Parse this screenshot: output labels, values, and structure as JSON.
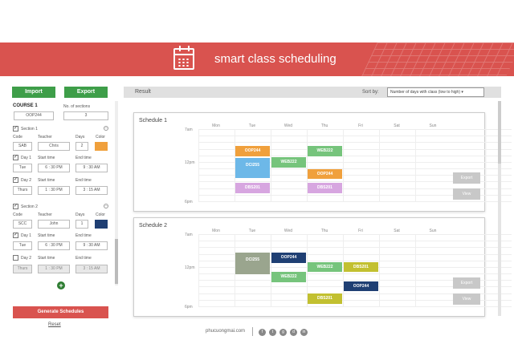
{
  "header": {
    "title": "smart class scheduling",
    "icon": "calendar-icon",
    "color": "#d9534f"
  },
  "toolbar": {
    "import_label": "Import",
    "export_label": "Export"
  },
  "course": {
    "label": "COURSE 1",
    "code": "OOP244",
    "sections_label": "No. of sections",
    "sections_value": "3"
  },
  "fields": {
    "code": "Code",
    "teacher": "Teacher",
    "days": "Days",
    "color": "Color",
    "start": "Start time",
    "end": "End time"
  },
  "sections": [
    {
      "label": "Section 1",
      "code": "SAB",
      "teacher": "Chris",
      "days": "2",
      "color": "#f0a03c",
      "days_list": [
        {
          "label": "Day 1",
          "day": "Tue",
          "start": "6 : 30 PM",
          "end": "9 : 30 AM",
          "checked": true
        },
        {
          "label": "Day 2",
          "day": "Thurs",
          "start": "1 : 30 PM",
          "end": "3 : 15 AM",
          "checked": true
        }
      ]
    },
    {
      "label": "Section 2",
      "code": "SCC",
      "teacher": "John",
      "days": "1",
      "color": "#1f3f73",
      "days_list": [
        {
          "label": "Day 1",
          "day": "Tue",
          "start": "6 : 30 PM",
          "end": "9 : 30 AM",
          "checked": true
        },
        {
          "label": "Day 2",
          "day": "Thurs",
          "start": "1 : 30 PM",
          "end": "3 : 15 AM",
          "checked": false
        }
      ]
    }
  ],
  "actions": {
    "generate": "Generate Schedules",
    "reset": "Reset"
  },
  "result": {
    "title": "Result",
    "sort_label": "Sort by:",
    "sort_value": "Number of days with class (low to high)"
  },
  "days": [
    "Mon",
    "Tue",
    "Wed",
    "Thu",
    "Fri",
    "Sat",
    "Sun"
  ],
  "time_labels": [
    "7am",
    "12pm",
    "6pm"
  ],
  "panel_buttons": {
    "export": "Export",
    "view": "View"
  },
  "schedules": [
    {
      "title": "Schedule 1",
      "blocks": [
        {
          "name": "OOP244",
          "day": 1,
          "start": 9.6,
          "end": 11.1,
          "color": "#f0a03c"
        },
        {
          "name": "DCI255",
          "day": 1,
          "start": 11.4,
          "end": 14.4,
          "color": "#6db8e8"
        },
        {
          "name": "DBS201",
          "day": 1,
          "start": 15.2,
          "end": 16.8,
          "color": "#d7a6e0"
        },
        {
          "name": "WEB222",
          "day": 2,
          "start": 11.3,
          "end": 12.9,
          "color": "#76c47c"
        },
        {
          "name": "WEB222",
          "day": 3,
          "start": 9.6,
          "end": 11.1,
          "color": "#76c47c"
        },
        {
          "name": "OOP244",
          "day": 3,
          "start": 13.1,
          "end": 14.6,
          "color": "#f0a03c"
        },
        {
          "name": "DBS201",
          "day": 3,
          "start": 15.2,
          "end": 16.8,
          "color": "#d7a6e0"
        }
      ]
    },
    {
      "title": "Schedule 2",
      "blocks": [
        {
          "name": "DCI255",
          "day": 1,
          "start": 9.8,
          "end": 13.1,
          "color": "#9aa58e"
        },
        {
          "name": "OOP244",
          "day": 2,
          "start": 9.8,
          "end": 11.4,
          "color": "#1f3f73"
        },
        {
          "name": "WEB222",
          "day": 2,
          "start": 12.8,
          "end": 14.3,
          "color": "#76c47c"
        },
        {
          "name": "WEB222",
          "day": 3,
          "start": 11.3,
          "end": 12.8,
          "color": "#76c47c"
        },
        {
          "name": "DBS201",
          "day": 3,
          "start": 16.0,
          "end": 17.6,
          "color": "#c2c030"
        },
        {
          "name": "DBS201",
          "day": 4,
          "start": 11.3,
          "end": 12.8,
          "color": "#c2c030"
        },
        {
          "name": "OOP244",
          "day": 4,
          "start": 14.2,
          "end": 15.7,
          "color": "#1f3f73"
        }
      ]
    }
  ],
  "footer": {
    "site": "phucuongmai.com",
    "social": [
      "facebook-icon",
      "twitter-icon",
      "github-icon",
      "dribbble-icon",
      "linkedin-icon"
    ],
    "social_glyphs": [
      "f",
      "t",
      "g",
      "d",
      "in"
    ]
  }
}
